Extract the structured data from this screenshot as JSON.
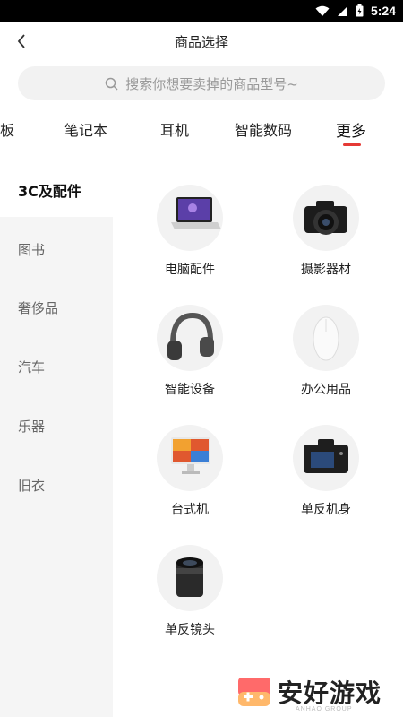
{
  "status_bar": {
    "time": "5:24",
    "icons": [
      "wifi-icon",
      "signal-icon",
      "battery-icon"
    ]
  },
  "header": {
    "title": "商品选择",
    "back_icon": "chevron-left-icon"
  },
  "search": {
    "placeholder": "搜索你想要卖掉的商品型号~",
    "icon": "search-icon"
  },
  "tabs": [
    {
      "label": "板"
    },
    {
      "label": "笔记本"
    },
    {
      "label": "耳机"
    },
    {
      "label": "智能数码"
    },
    {
      "label": "更多",
      "active": true
    }
  ],
  "accent_color": "#e53935",
  "sidebar": {
    "items": [
      {
        "label": "3C及配件",
        "active": true
      },
      {
        "label": "图书"
      },
      {
        "label": "奢侈品"
      },
      {
        "label": "汽车"
      },
      {
        "label": "乐器"
      },
      {
        "label": "旧衣"
      }
    ]
  },
  "products": [
    {
      "label": "电脑配件",
      "icon": "laptop-icon"
    },
    {
      "label": "摄影器材",
      "icon": "camera-icon"
    },
    {
      "label": "智能设备",
      "icon": "headphones-icon"
    },
    {
      "label": "办公用品",
      "icon": "mouse-icon"
    },
    {
      "label": "台式机",
      "icon": "monitor-icon"
    },
    {
      "label": "单反机身",
      "icon": "dslr-body-icon"
    },
    {
      "label": "单反镜头",
      "icon": "lens-icon"
    }
  ],
  "watermark": {
    "text": "安好游戏",
    "sub": "ANHAO GROUP"
  }
}
